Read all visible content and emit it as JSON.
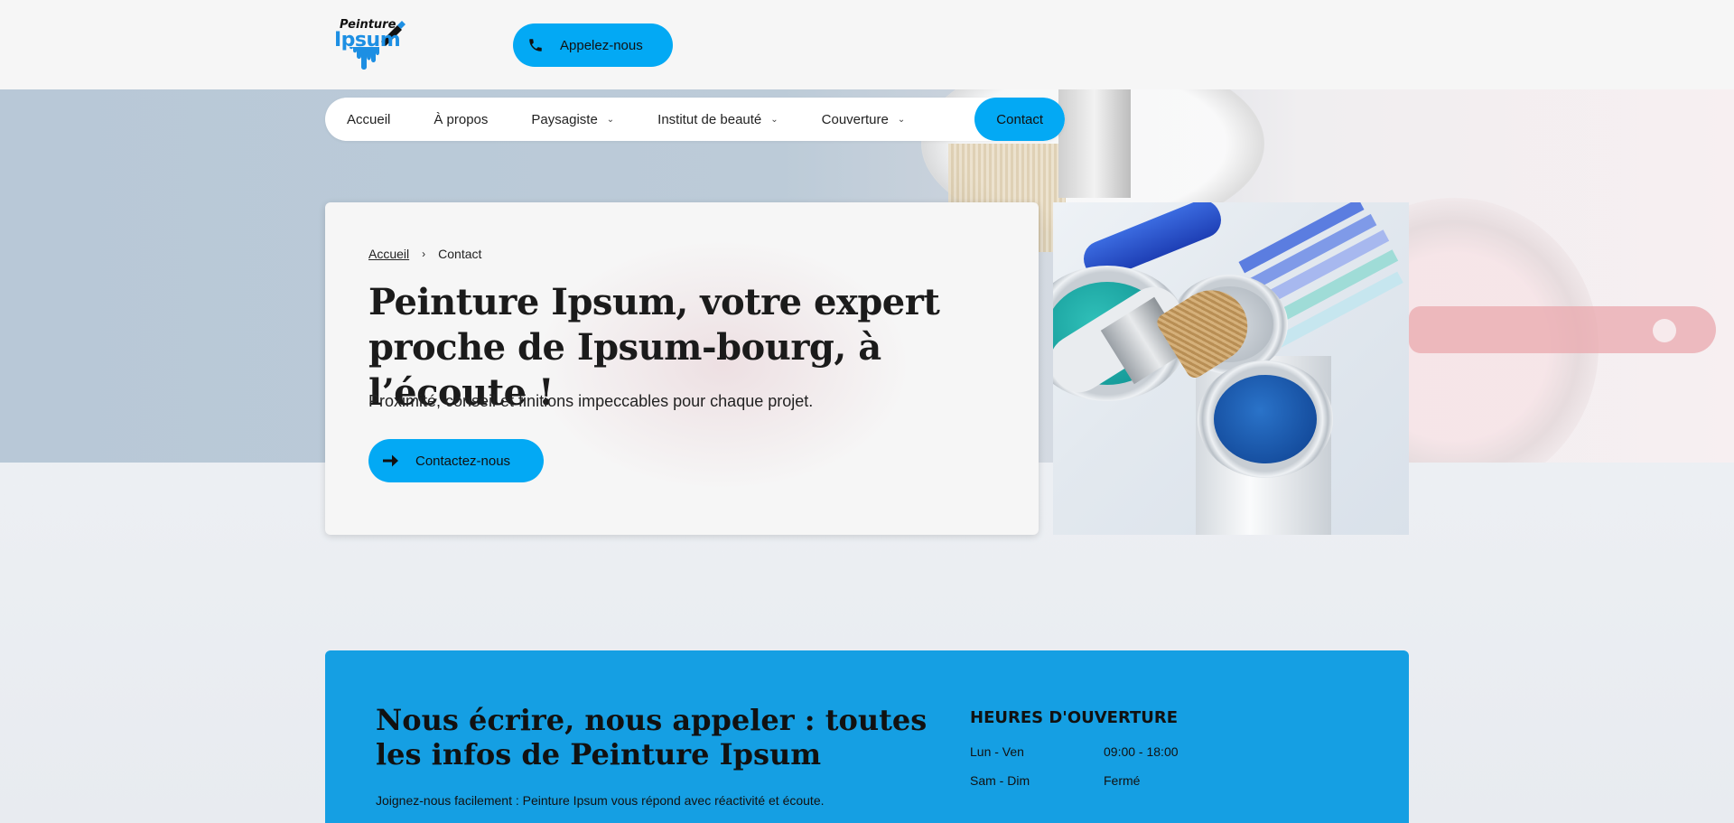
{
  "header": {
    "logo_top": "Peinture",
    "logo_main": "Ipsum",
    "call_button_label": "Appelez-nous"
  },
  "nav": {
    "items": [
      {
        "label": "Accueil",
        "has_dropdown": false
      },
      {
        "label": "À propos",
        "has_dropdown": false
      },
      {
        "label": "Paysagiste",
        "has_dropdown": true
      },
      {
        "label": "Institut de beauté",
        "has_dropdown": true
      },
      {
        "label": "Couverture",
        "has_dropdown": true
      }
    ],
    "active_label": "Contact"
  },
  "hero": {
    "breadcrumb": {
      "home": "Accueil",
      "separator": "›",
      "current": "Contact"
    },
    "title": "Peinture Ipsum, votre expert proche de Ipsum-bourg, à l’écoute !",
    "subtitle": "Proximité, conseil et finitions impeccables pour chaque projet.",
    "cta_label": "Contactez-nous"
  },
  "contact": {
    "title": "Nous écrire, nous appeler : toutes les infos de Peinture Ipsum",
    "subtitle": "Joignez-nous facilement : Peinture Ipsum vous répond avec réactivité et écoute.",
    "hours_title": "HEURES D'OUVERTURE",
    "hours": [
      {
        "days": "Lun - Ven",
        "time": "09:00 - 18:00"
      },
      {
        "days": "Sam - Dim",
        "time": "Fermé"
      }
    ]
  },
  "colors": {
    "accent": "#03a9f4",
    "contact_band": "#159fe3",
    "logo_blue": "#1d8fe3"
  },
  "icons": {
    "call": "phone-icon",
    "cta": "arrow-right-icon",
    "dropdown": "chevron-down-icon",
    "breadcrumb_sep": "chevron-right-icon"
  }
}
